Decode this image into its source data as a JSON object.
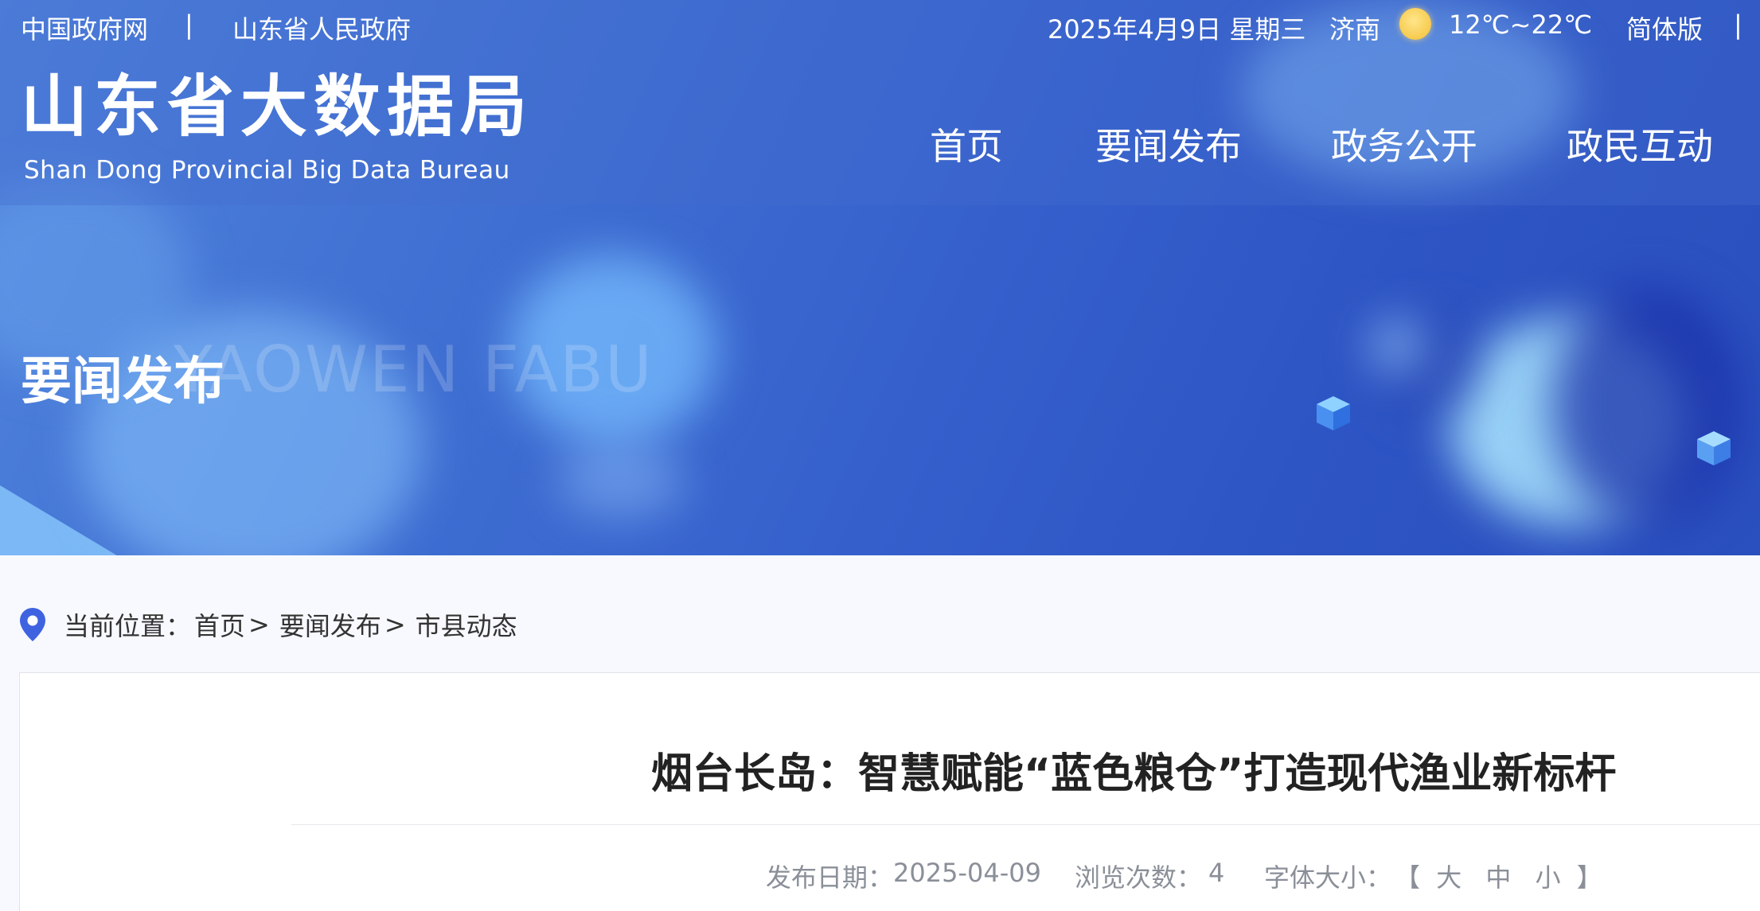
{
  "topbar": {
    "link_gov_cn": "中国政府网",
    "divider": "|",
    "link_sd_gov": "山东省人民政府",
    "date": "2025年4月9日 星期三",
    "city": "济南",
    "weather_icon": "sun-icon",
    "temperature": "12℃~22℃",
    "lang": "简体版",
    "lang_divider": "|"
  },
  "brand": {
    "name_cn": "山东省大数据局",
    "name_en": "Shan Dong Provincial Big Data Bureau"
  },
  "nav": {
    "items": [
      "首页",
      "要闻发布",
      "政务公开",
      "政民互动"
    ]
  },
  "section": {
    "title_cn": "要闻发布",
    "title_en": "YAOWEN FABU"
  },
  "breadcrumb": {
    "label": "当前位置：",
    "items": [
      "首页",
      "要闻发布",
      "市县动态"
    ],
    "separator": ">"
  },
  "article": {
    "title": "烟台长岛：智慧赋能“蓝色粮仓”打造现代渔业新标杆",
    "date_label": "发布日期：",
    "date": "2025-04-09",
    "views_label": "浏览次数：",
    "views": "4",
    "font_label": "字体大小：",
    "font_open": "【",
    "font_large": "大",
    "font_medium": "中",
    "font_small": "小",
    "font_close": "】"
  },
  "colors": {
    "banner_blue": "#3a66cc",
    "pin_blue": "#3f63e0",
    "title_text": "#222222",
    "meta_text": "#8a8f98"
  }
}
